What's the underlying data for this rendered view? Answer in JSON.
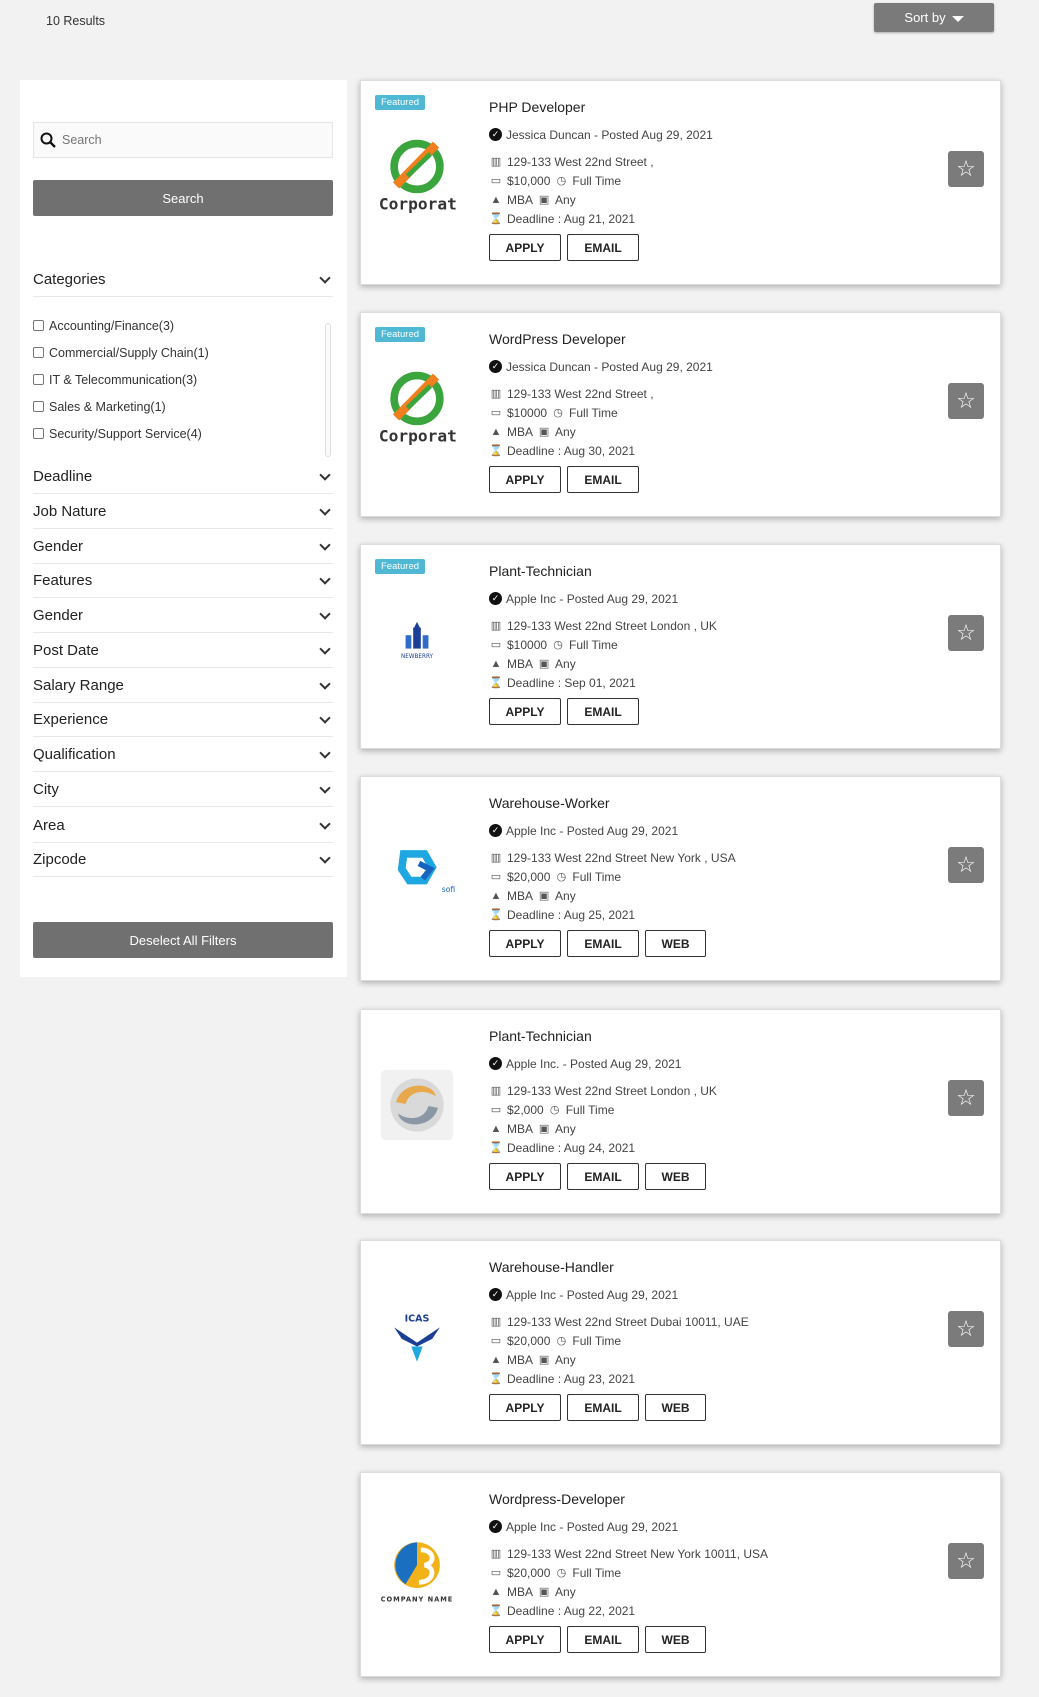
{
  "header": {
    "results_label": "10 Results",
    "sort_label": "Sort by"
  },
  "sidebar": {
    "search_placeholder": "Search",
    "search_button": "Search",
    "categories_title": "Categories",
    "categories": [
      "Accounting/Finance(3)",
      "Commercial/Supply Chain(1)",
      "IT & Telecommunication(3)",
      "Sales & Marketing(1)",
      "Security/Support Service(4)"
    ],
    "filters": [
      "Deadline",
      "Job Nature",
      "Gender",
      "Features",
      "Gender",
      "Post Date",
      "Salary Range",
      "Experience",
      "Qualification",
      "City",
      "Area",
      "Zipcode"
    ],
    "deselect_button": "Deselect All Filters"
  },
  "labels": {
    "featured": "Featured",
    "apply": "APPLY",
    "email": "EMAIL",
    "web": "WEB",
    "deadline_prefix": "Deadline :"
  },
  "jobs": [
    {
      "title": "PHP Developer",
      "featured": true,
      "poster": "Jessica Duncan - Posted Aug 29, 2021",
      "address": "129-133 West 22nd Street ,",
      "salary": "$10,000",
      "job_type": "Full Time",
      "degree": "MBA",
      "experience": "Any",
      "deadline": "Deadline : Aug 21, 2021",
      "logo": "corporate",
      "logo_text": "Corporat",
      "has_web": false
    },
    {
      "title": "WordPress Developer",
      "featured": true,
      "poster": "Jessica Duncan - Posted Aug 29, 2021",
      "address": "129-133 West 22nd Street ,",
      "salary": "$10000",
      "job_type": "Full Time",
      "degree": "MBA",
      "experience": "Any",
      "deadline": "Deadline : Aug 30, 2021",
      "logo": "corporate",
      "logo_text": "Corporat",
      "has_web": false
    },
    {
      "title": "Plant-Technician",
      "featured": true,
      "poster": "Apple Inc - Posted Aug 29, 2021",
      "address": "129-133 West 22nd Street London , UK",
      "salary": "$10000",
      "job_type": "Full Time",
      "degree": "MBA",
      "experience": "Any",
      "deadline": "Deadline : Sep 01, 2021",
      "logo": "newberry",
      "logo_text": "NEWBERRY",
      "has_web": false
    },
    {
      "title": "Warehouse-Worker",
      "featured": false,
      "poster": "Apple Inc - Posted Aug 29, 2021",
      "address": "129-133 West 22nd Street New York , USA",
      "salary": "$20,000",
      "job_type": "Full Time",
      "degree": "MBA",
      "experience": "Any",
      "deadline": "Deadline : Aug 25, 2021",
      "logo": "sofi",
      "logo_text": "sofi",
      "has_web": true
    },
    {
      "title": "Plant-Technician",
      "featured": false,
      "poster": "Apple Inc. - Posted Aug 29, 2021",
      "address": "129-133 West 22nd Street London , UK",
      "salary": "$2,000",
      "job_type": "Full Time",
      "degree": "MBA",
      "experience": "Any",
      "deadline": "Deadline : Aug 24, 2021",
      "logo": "swirl",
      "logo_text": "",
      "has_web": true
    },
    {
      "title": "Warehouse-Handler",
      "featured": false,
      "poster": "Apple Inc - Posted Aug 29, 2021",
      "address": "129-133 West 22nd Street Dubai 10011, UAE",
      "salary": "$20,000",
      "job_type": "Full Time",
      "degree": "MBA",
      "experience": "Any",
      "deadline": "Deadline : Aug 23, 2021",
      "logo": "icas",
      "logo_text": "ICAS",
      "has_web": true
    },
    {
      "title": "Wordpress-Developer",
      "featured": false,
      "poster": "Apple Inc - Posted Aug 29, 2021",
      "address": "129-133 West 22nd Street New York 10011, USA",
      "salary": "$20,000",
      "job_type": "Full Time",
      "degree": "MBA",
      "experience": "Any",
      "deadline": "Deadline : Aug 22, 2021",
      "logo": "company",
      "logo_text": "COMPANY NAME",
      "has_web": true
    }
  ],
  "colors": {
    "featured_badge": "#4fb8d3",
    "button_gray": "#707070",
    "star_button": "#7b7b7b"
  }
}
